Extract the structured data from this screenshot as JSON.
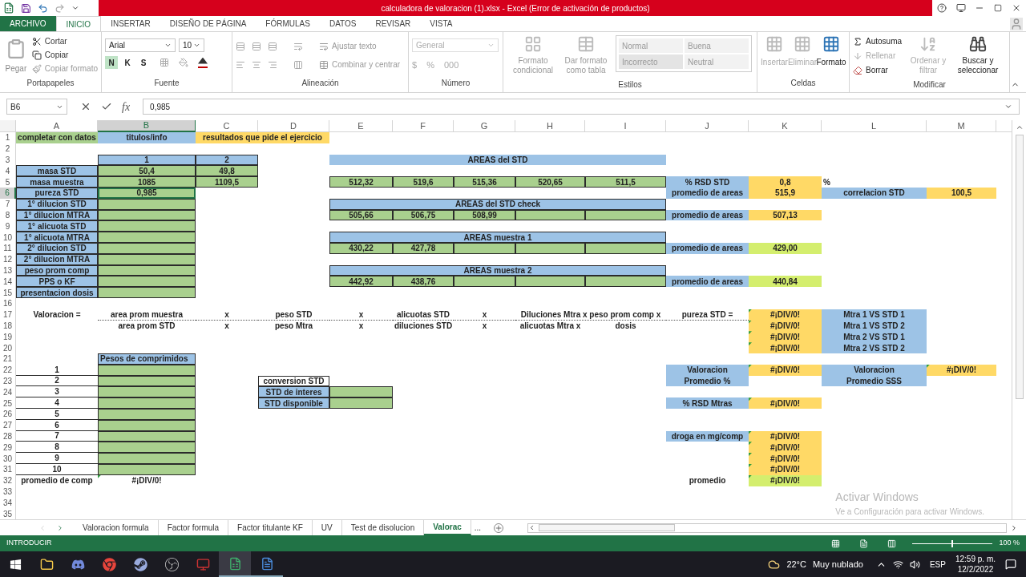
{
  "window": {
    "title": "calculadora de valoracion (1).xlsx - Excel (Error de activación de productos)"
  },
  "ribbon": {
    "tabs": [
      {
        "label": "ARCHIVO",
        "kind": "file",
        "selected": false
      },
      {
        "label": "INICIO",
        "kind": "tab",
        "selected": true
      },
      {
        "label": "INSERTAR",
        "kind": "tab",
        "selected": false
      },
      {
        "label": "DISEÑO DE PÁGINA",
        "kind": "tab",
        "selected": false
      },
      {
        "label": "FÓRMULAS",
        "kind": "tab",
        "selected": false
      },
      {
        "label": "DATOS",
        "kind": "tab",
        "selected": false
      },
      {
        "label": "REVISAR",
        "kind": "tab",
        "selected": false
      },
      {
        "label": "VISTA",
        "kind": "tab",
        "selected": false
      }
    ],
    "groups": [
      {
        "kind": "clipboard",
        "label": "Portapapeles",
        "paste": "Pegar",
        "items": [
          "Cortar",
          "Copiar",
          "Copiar formato"
        ]
      },
      {
        "kind": "font",
        "label": "Fuente",
        "font": "Arial",
        "size": "10",
        "styles": [
          {
            "label": "N",
            "selected": true
          },
          {
            "label": "K",
            "selected": false
          },
          {
            "label": "S",
            "selected": false
          }
        ]
      },
      {
        "kind": "alignment",
        "label": "Alineación",
        "items": [
          "Ajustar texto",
          "Combinar y centrar"
        ]
      },
      {
        "kind": "number",
        "label": "Número",
        "format": "General",
        "symbols": [
          "$",
          "%",
          "000"
        ]
      },
      {
        "kind": "styles",
        "label": "Estilos",
        "buttons": [
          "Formato condicional",
          "Dar formato como tabla"
        ],
        "cell_styles": [
          "Normal",
          "Buena",
          "Incorrecto",
          "Neutral"
        ]
      },
      {
        "kind": "cells",
        "label": "Celdas",
        "buttons": [
          {
            "label": "Insertar",
            "disabled": true
          },
          {
            "label": "Eliminar",
            "disabled": true
          },
          {
            "label": "Formato",
            "disabled": false
          }
        ]
      },
      {
        "kind": "editing",
        "label": "Modificar",
        "items": [
          {
            "label": "Autosuma",
            "disabled": false
          },
          {
            "label": "Rellenar",
            "disabled": true
          },
          {
            "label": "Borrar",
            "disabled": false
          }
        ],
        "buttons": [
          {
            "label": "Ordenar y filtrar",
            "disabled": true
          },
          {
            "label": "Buscar y seleccionar",
            "disabled": false
          }
        ]
      }
    ]
  },
  "formula_bar": {
    "name_box": "B6",
    "function_label": "fx",
    "value": "0,985"
  },
  "sheet": {
    "columns": [
      {
        "label": "A",
        "selected": false
      },
      {
        "label": "B",
        "selected": true
      },
      {
        "label": "C",
        "selected": false
      },
      {
        "label": "D",
        "selected": false
      },
      {
        "label": "E",
        "selected": false
      },
      {
        "label": "F",
        "selected": false
      },
      {
        "label": "G",
        "selected": false
      },
      {
        "label": "H",
        "selected": false
      },
      {
        "label": "I",
        "selected": false
      },
      {
        "label": "J",
        "selected": false
      },
      {
        "label": "K",
        "selected": false
      },
      {
        "label": "L",
        "selected": false
      },
      {
        "label": "M",
        "selected": false
      }
    ],
    "rows": [
      {
        "label": "1",
        "selected": false,
        "cells": {
          "A": {
            "text": "completar con datos",
            "kind": "key_input"
          },
          "B": {
            "text": "titulos/info",
            "kind": "label"
          },
          "C": {
            "text": "resultados que pide el ejercicio",
            "kind": "result"
          }
        }
      },
      {
        "label": "2",
        "selected": false
      },
      {
        "label": "3",
        "selected": false,
        "cells": {
          "B": {
            "text": "1",
            "kind": "header"
          },
          "C": {
            "text": "2",
            "kind": "header"
          },
          "E": {
            "text": "AREAS del STD",
            "kind": "label"
          }
        }
      },
      {
        "label": "4",
        "selected": false,
        "cells": {
          "A": {
            "text": "masa STD",
            "kind": "header"
          },
          "B": {
            "text": "50,4",
            "kind": "input"
          },
          "C": {
            "text": "49,8",
            "kind": "input"
          }
        }
      },
      {
        "label": "5",
        "selected": false,
        "cells": {
          "A": {
            "text": "masa muestra",
            "kind": "header"
          },
          "B": {
            "text": "1085",
            "kind": "input"
          },
          "C": {
            "text": "1109,5",
            "kind": "input"
          },
          "E": {
            "text": "512,32",
            "kind": "input"
          },
          "F": {
            "text": "519,6",
            "kind": "input"
          },
          "G": {
            "text": "515,36",
            "kind": "input"
          },
          "H": {
            "text": "520,65",
            "kind": "input"
          },
          "I": {
            "text": "511,5",
            "kind": "input"
          },
          "J": {
            "text": "% RSD STD",
            "kind": "label"
          },
          "K": {
            "text": "0,8",
            "kind": "result"
          },
          "L": {
            "text": "%",
            "kind": "note"
          }
        }
      },
      {
        "label": "6",
        "selected": true,
        "cells": {
          "A": {
            "text": "pureza STD",
            "kind": "header"
          },
          "B": {
            "text": "0,985",
            "kind": "input"
          },
          "J": {
            "text": "promedio de areas",
            "kind": "label"
          },
          "K": {
            "text": "515,9",
            "kind": "result"
          },
          "L": {
            "text": "correlacion STD",
            "kind": "label"
          },
          "M": {
            "text": "100,5",
            "kind": "result"
          }
        }
      },
      {
        "label": "7",
        "selected": false,
        "cells": {
          "A": {
            "text": "1° dilucion STD",
            "kind": "header"
          },
          "B": {
            "kind": "input"
          },
          "E": {
            "text": "AREAS del STD check",
            "kind": "header"
          }
        }
      },
      {
        "label": "8",
        "selected": false,
        "cells": {
          "A": {
            "text": "1° dilucion MTRA",
            "kind": "header"
          },
          "B": {
            "kind": "input"
          },
          "E": {
            "text": "505,66",
            "kind": "input"
          },
          "F": {
            "text": "506,75",
            "kind": "input"
          },
          "G": {
            "text": "508,99",
            "kind": "input"
          },
          "H": {
            "kind": "input"
          },
          "I": {
            "kind": "input"
          },
          "J": {
            "text": "promedio de areas",
            "kind": "label"
          },
          "K": {
            "text": "507,13",
            "kind": "result"
          }
        }
      },
      {
        "label": "9",
        "selected": false,
        "cells": {
          "A": {
            "text": "1° alicuota STD",
            "kind": "header"
          },
          "B": {
            "kind": "input"
          }
        }
      },
      {
        "label": "10",
        "selected": false,
        "cells": {
          "A": {
            "text": "1° alicuota MTRA",
            "kind": "header"
          },
          "B": {
            "kind": "input"
          },
          "E": {
            "text": "AREAS muestra 1",
            "kind": "header"
          }
        }
      },
      {
        "label": "11",
        "selected": false,
        "cells": {
          "A": {
            "text": "2° dilucion STD",
            "kind": "header"
          },
          "B": {
            "kind": "input"
          },
          "E": {
            "text": "430,22",
            "kind": "input"
          },
          "F": {
            "text": "427,78",
            "kind": "input"
          },
          "G": {
            "kind": "input"
          },
          "H": {
            "kind": "input"
          },
          "I": {
            "kind": "input"
          },
          "J": {
            "text": "promedio de areas",
            "kind": "label"
          },
          "K": {
            "text": "429,00",
            "kind": "check"
          }
        }
      },
      {
        "label": "12",
        "selected": false,
        "cells": {
          "A": {
            "text": "2° dilucion MTRA",
            "kind": "header"
          },
          "B": {
            "kind": "input"
          }
        }
      },
      {
        "label": "13",
        "selected": false,
        "cells": {
          "A": {
            "text": "peso prom comp",
            "kind": "header"
          },
          "B": {
            "kind": "input"
          },
          "E": {
            "text": "AREAS muestra 2",
            "kind": "header"
          }
        }
      },
      {
        "label": "14",
        "selected": false,
        "cells": {
          "A": {
            "text": "PPS o KF",
            "kind": "header"
          },
          "B": {
            "kind": "input"
          },
          "E": {
            "text": "442,92",
            "kind": "input"
          },
          "F": {
            "text": "438,76",
            "kind": "input"
          },
          "G": {
            "kind": "input"
          },
          "H": {
            "kind": "input"
          },
          "I": {
            "kind": "input"
          },
          "J": {
            "text": "promedio de areas",
            "kind": "label"
          },
          "K": {
            "text": "440,84",
            "kind": "check"
          }
        }
      },
      {
        "label": "15",
        "selected": false,
        "cells": {
          "A": {
            "text": "presentacion dosis",
            "kind": "header"
          },
          "B": {
            "kind": "input"
          }
        }
      },
      {
        "label": "16",
        "selected": false
      },
      {
        "label": "17",
        "selected": false,
        "cells": {
          "A": {
            "text": "Valoracion =",
            "kind": "plain"
          },
          "B": {
            "text": "area prom muestra",
            "kind": "formula"
          },
          "C": {
            "text": "x",
            "kind": "formula"
          },
          "D": {
            "text": "peso STD",
            "kind": "formula"
          },
          "E": {
            "text": "x",
            "kind": "formula"
          },
          "F": {
            "text": "alicuotas STD",
            "kind": "formula"
          },
          "G": {
            "text": "x",
            "kind": "formula"
          },
          "H": {
            "text": "Diluciones Mtra x peso prom comp x",
            "kind": "formula"
          },
          "J": {
            "text": "pureza STD =",
            "kind": "formula"
          },
          "K": {
            "text": "#¡DIV/0!",
            "kind": "result_flagged"
          },
          "L": {
            "text": "Mtra 1 VS STD 1",
            "kind": "label"
          }
        }
      },
      {
        "label": "18",
        "selected": false,
        "cells": {
          "B": {
            "text": "area prom STD",
            "kind": "plain"
          },
          "C": {
            "text": "x",
            "kind": "plain"
          },
          "D": {
            "text": "peso Mtra",
            "kind": "plain"
          },
          "E": {
            "text": "x",
            "kind": "plain"
          },
          "F": {
            "text": "diluciones STD",
            "kind": "plain"
          },
          "G": {
            "text": "x",
            "kind": "plain"
          },
          "H": {
            "text": "alicuotas Mtra x",
            "kind": "plain"
          },
          "I": {
            "text": "dosis",
            "kind": "plain"
          },
          "K": {
            "text": "#¡DIV/0!",
            "kind": "result_flagged"
          },
          "L": {
            "text": "Mtra 1 VS STD 2",
            "kind": "label"
          }
        }
      },
      {
        "label": "19",
        "selected": false,
        "cells": {
          "K": {
            "text": "#¡DIV/0!",
            "kind": "result_flagged"
          },
          "L": {
            "text": "Mtra 2 VS STD 1",
            "kind": "label"
          }
        }
      },
      {
        "label": "20",
        "selected": false,
        "cells": {
          "K": {
            "text": "#¡DIV/0!",
            "kind": "result_flagged"
          },
          "L": {
            "text": "Mtra 2 VS STD 2",
            "kind": "label"
          }
        }
      },
      {
        "label": "21",
        "selected": false,
        "cells": {
          "B": {
            "text": "Pesos de comprimidos",
            "kind": "header_left"
          }
        }
      },
      {
        "label": "22",
        "selected": false,
        "cells": {
          "A": {
            "text": "1",
            "kind": "numbered"
          },
          "B": {
            "kind": "input"
          },
          "J": {
            "text": "Valoracion",
            "kind": "label"
          },
          "K": {
            "text": "#¡DIV/0!",
            "kind": "result_flagged"
          },
          "L": {
            "text": "Valoracion",
            "kind": "label"
          },
          "M": {
            "text": "#¡DIV/0!",
            "kind": "result_flagged"
          }
        }
      },
      {
        "label": "23",
        "selected": false,
        "cells": {
          "A": {
            "text": "2",
            "kind": "numbered"
          },
          "B": {
            "kind": "input"
          },
          "D": {
            "text": "conversion STD",
            "kind": "box"
          },
          "J": {
            "text": "Promedio %",
            "kind": "label"
          },
          "L": {
            "text": "Promedio SSS",
            "kind": "label"
          }
        }
      },
      {
        "label": "24",
        "selected": false,
        "cells": {
          "A": {
            "text": "3",
            "kind": "numbered"
          },
          "B": {
            "kind": "input"
          },
          "D": {
            "text": "STD de interes",
            "kind": "header"
          },
          "E": {
            "kind": "input"
          }
        }
      },
      {
        "label": "25",
        "selected": false,
        "cells": {
          "A": {
            "text": "4",
            "kind": "numbered"
          },
          "B": {
            "kind": "input"
          },
          "D": {
            "text": "STD disponible",
            "kind": "header"
          },
          "E": {
            "kind": "input"
          },
          "J": {
            "text": "% RSD Mtras",
            "kind": "label"
          },
          "K": {
            "text": "#¡DIV/0!",
            "kind": "result_flagged"
          }
        }
      },
      {
        "label": "26",
        "selected": false,
        "cells": {
          "A": {
            "text": "5",
            "kind": "numbered"
          },
          "B": {
            "kind": "input"
          }
        }
      },
      {
        "label": "27",
        "selected": false,
        "cells": {
          "A": {
            "text": "6",
            "kind": "numbered"
          },
          "B": {
            "kind": "input"
          }
        }
      },
      {
        "label": "28",
        "selected": false,
        "cells": {
          "A": {
            "text": "7",
            "kind": "numbered"
          },
          "B": {
            "kind": "input"
          },
          "J": {
            "text": "droga en mg/comp",
            "kind": "label"
          },
          "K": {
            "text": "#¡DIV/0!",
            "kind": "result_flagged"
          }
        }
      },
      {
        "label": "29",
        "selected": false,
        "cells": {
          "A": {
            "text": "8",
            "kind": "numbered"
          },
          "B": {
            "kind": "input"
          },
          "K": {
            "text": "#¡DIV/0!",
            "kind": "result_flagged"
          }
        }
      },
      {
        "label": "30",
        "selected": false,
        "cells": {
          "A": {
            "text": "9",
            "kind": "numbered"
          },
          "B": {
            "kind": "input"
          },
          "K": {
            "text": "#¡DIV/0!",
            "kind": "result_flagged"
          }
        }
      },
      {
        "label": "31",
        "selected": false,
        "cells": {
          "A": {
            "text": "10",
            "kind": "numbered"
          },
          "B": {
            "kind": "input"
          },
          "K": {
            "text": "#¡DIV/0!",
            "kind": "result_flagged"
          }
        }
      },
      {
        "label": "32",
        "selected": false,
        "cells": {
          "A": {
            "text": "promedio de comp",
            "kind": "plain"
          },
          "B": {
            "text": "#¡DIV/0!",
            "kind": "plain_flagged"
          },
          "J": {
            "text": "promedio",
            "kind": "plain"
          },
          "K": {
            "text": "#¡DIV/0!",
            "kind": "check_flagged"
          }
        }
      },
      {
        "label": "33",
        "selected": false
      },
      {
        "label": "34",
        "selected": false
      },
      {
        "label": "35",
        "selected": false
      }
    ]
  },
  "activation_notice": {
    "title": "Activar Windows",
    "body": "Ve a Configuración para activar Windows."
  },
  "sheet_tabs": {
    "tabs": [
      {
        "label": "Valoracion formula",
        "selected": false
      },
      {
        "label": "Factor formula",
        "selected": false
      },
      {
        "label": "Factor titulante KF",
        "selected": false
      },
      {
        "label": "UV",
        "selected": false
      },
      {
        "label": "Test de disolucion",
        "selected": false
      },
      {
        "label": "Valorac",
        "selected": true
      }
    ],
    "more": "..."
  },
  "status_bar": {
    "mode": "INTRODUCIR",
    "zoom": "100 %",
    "zoom_slider": {
      "level": 0.5
    }
  },
  "taskbar": {
    "temperature": "22°C",
    "weather": "Muy nublado",
    "language": "ESP",
    "time": "12:59 p. m.",
    "date": "12/2/2022"
  }
}
